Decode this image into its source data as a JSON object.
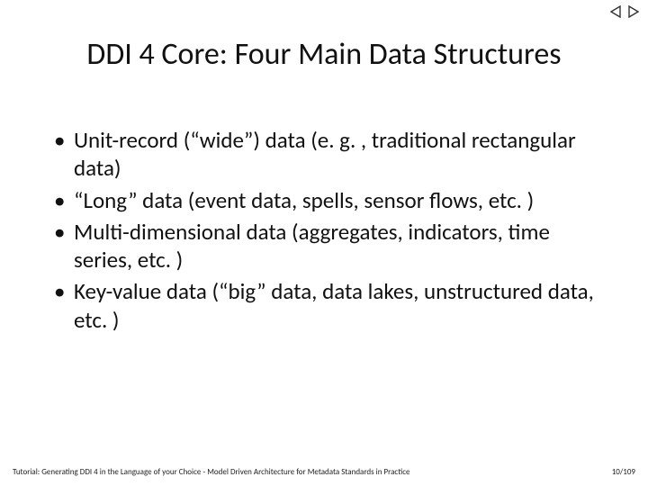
{
  "nav": {
    "prev_icon": "prev-triangle",
    "next_icon": "next-triangle"
  },
  "title": "DDI 4 Core: Four Main Data Structures",
  "bullets": [
    "Unit-record (“wide”) data (e. g. , traditional rectangular data)",
    "“Long” data (event data, spells, sensor flows, etc. )",
    "Multi-dimensional data (aggregates, indicators, time series, etc. )",
    "Key-value data (“big” data, data lakes, unstructured data, etc. )"
  ],
  "footer": {
    "left": "Tutorial: Generating DDI 4 in the Language of your Choice -  Model Driven Architecture for Metadata Standards in Practice",
    "right": "10/109"
  }
}
